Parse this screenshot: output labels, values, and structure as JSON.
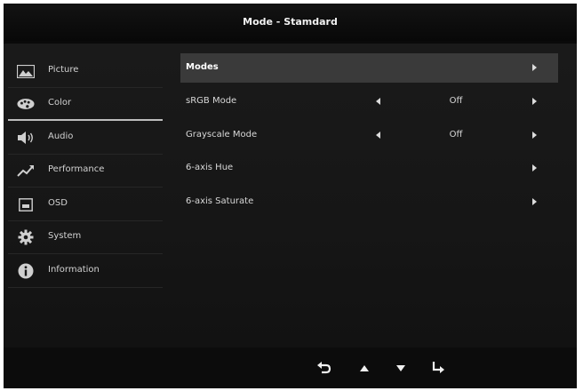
{
  "header": {
    "title": "Mode - Stamdard"
  },
  "sidebar": {
    "items": [
      {
        "label": "Picture",
        "icon": "picture-icon"
      },
      {
        "label": "Color",
        "icon": "color-palette-icon"
      },
      {
        "label": "Audio",
        "icon": "speaker-icon"
      },
      {
        "label": "Performance",
        "icon": "performance-graph-icon"
      },
      {
        "label": "OSD",
        "icon": "osd-screen-icon"
      },
      {
        "label": "System",
        "icon": "gear-icon"
      },
      {
        "label": "Information",
        "icon": "info-icon"
      }
    ],
    "active": "Color"
  },
  "menu": {
    "rows": [
      {
        "label": "Modes"
      },
      {
        "label": "sRGB Mode",
        "value": "Off"
      },
      {
        "label": "Grayscale Mode",
        "value": "Off"
      },
      {
        "label": "6-axis Hue"
      },
      {
        "label": "6-axis Saturate"
      }
    ],
    "highlighted": "Modes"
  },
  "bottom_nav": {
    "buttons": [
      "back-icon",
      "up-arrow-icon",
      "down-arrow-icon",
      "enter-icon"
    ]
  },
  "colors": {
    "background": "#0a0a0a",
    "panel": "#161616",
    "highlight": "#3a3a3a",
    "text": "#d8d8d8"
  }
}
